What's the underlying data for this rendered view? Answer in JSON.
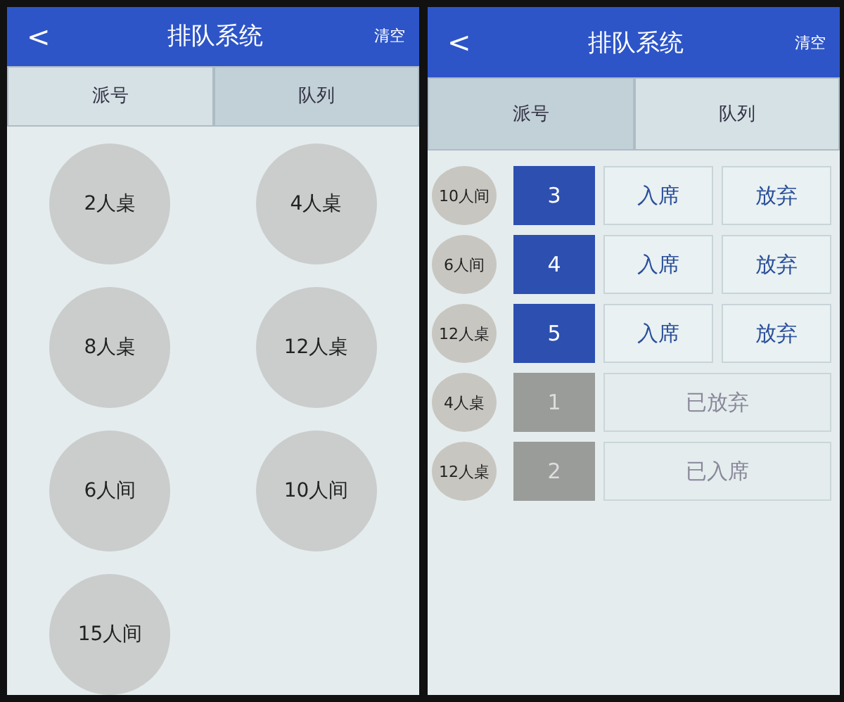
{
  "screens": [
    {
      "header": {
        "back": "<",
        "title": "排队系统",
        "action": "清空"
      },
      "tabs": [
        {
          "label": "派号",
          "selected": true
        },
        {
          "label": "队列",
          "selected": false
        }
      ],
      "kind": "dispatch",
      "tables": [
        "2人桌",
        "4人桌",
        "8人桌",
        "12人桌",
        "6人间",
        "10人间",
        "15人间"
      ]
    },
    {
      "header": {
        "back": "<",
        "title": "排队系统",
        "action": "清空"
      },
      "tabs": [
        {
          "label": "派号",
          "selected": false
        },
        {
          "label": "队列",
          "selected": true
        }
      ],
      "kind": "queue",
      "queue": [
        {
          "table": "10人间",
          "number": "3",
          "kind": "waiting",
          "seat": "入席",
          "abandon": "放弃"
        },
        {
          "table": "6人间",
          "number": "4",
          "kind": "waiting",
          "seat": "入席",
          "abandon": "放弃"
        },
        {
          "table": "12人桌",
          "number": "5",
          "kind": "waiting",
          "seat": "入席",
          "abandon": "放弃"
        },
        {
          "table": "4人桌",
          "number": "1",
          "kind": "done",
          "status": "已放弃"
        },
        {
          "table": "12人桌",
          "number": "2",
          "kind": "done",
          "status": "已入席"
        }
      ]
    }
  ]
}
